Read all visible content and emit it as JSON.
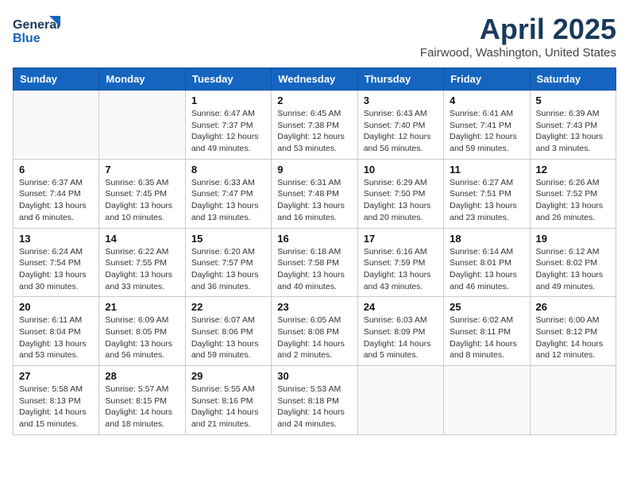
{
  "header": {
    "logo_line1": "General",
    "logo_line2": "Blue",
    "title": "April 2025",
    "location": "Fairwood, Washington, United States"
  },
  "weekdays": [
    "Sunday",
    "Monday",
    "Tuesday",
    "Wednesday",
    "Thursday",
    "Friday",
    "Saturday"
  ],
  "weeks": [
    [
      {
        "day": "",
        "detail": ""
      },
      {
        "day": "",
        "detail": ""
      },
      {
        "day": "1",
        "detail": "Sunrise: 6:47 AM\nSunset: 7:37 PM\nDaylight: 12 hours\nand 49 minutes."
      },
      {
        "day": "2",
        "detail": "Sunrise: 6:45 AM\nSunset: 7:38 PM\nDaylight: 12 hours\nand 53 minutes."
      },
      {
        "day": "3",
        "detail": "Sunrise: 6:43 AM\nSunset: 7:40 PM\nDaylight: 12 hours\nand 56 minutes."
      },
      {
        "day": "4",
        "detail": "Sunrise: 6:41 AM\nSunset: 7:41 PM\nDaylight: 12 hours\nand 59 minutes."
      },
      {
        "day": "5",
        "detail": "Sunrise: 6:39 AM\nSunset: 7:43 PM\nDaylight: 13 hours\nand 3 minutes."
      }
    ],
    [
      {
        "day": "6",
        "detail": "Sunrise: 6:37 AM\nSunset: 7:44 PM\nDaylight: 13 hours\nand 6 minutes."
      },
      {
        "day": "7",
        "detail": "Sunrise: 6:35 AM\nSunset: 7:45 PM\nDaylight: 13 hours\nand 10 minutes."
      },
      {
        "day": "8",
        "detail": "Sunrise: 6:33 AM\nSunset: 7:47 PM\nDaylight: 13 hours\nand 13 minutes."
      },
      {
        "day": "9",
        "detail": "Sunrise: 6:31 AM\nSunset: 7:48 PM\nDaylight: 13 hours\nand 16 minutes."
      },
      {
        "day": "10",
        "detail": "Sunrise: 6:29 AM\nSunset: 7:50 PM\nDaylight: 13 hours\nand 20 minutes."
      },
      {
        "day": "11",
        "detail": "Sunrise: 6:27 AM\nSunset: 7:51 PM\nDaylight: 13 hours\nand 23 minutes."
      },
      {
        "day": "12",
        "detail": "Sunrise: 6:26 AM\nSunset: 7:52 PM\nDaylight: 13 hours\nand 26 minutes."
      }
    ],
    [
      {
        "day": "13",
        "detail": "Sunrise: 6:24 AM\nSunset: 7:54 PM\nDaylight: 13 hours\nand 30 minutes."
      },
      {
        "day": "14",
        "detail": "Sunrise: 6:22 AM\nSunset: 7:55 PM\nDaylight: 13 hours\nand 33 minutes."
      },
      {
        "day": "15",
        "detail": "Sunrise: 6:20 AM\nSunset: 7:57 PM\nDaylight: 13 hours\nand 36 minutes."
      },
      {
        "day": "16",
        "detail": "Sunrise: 6:18 AM\nSunset: 7:58 PM\nDaylight: 13 hours\nand 40 minutes."
      },
      {
        "day": "17",
        "detail": "Sunrise: 6:16 AM\nSunset: 7:59 PM\nDaylight: 13 hours\nand 43 minutes."
      },
      {
        "day": "18",
        "detail": "Sunrise: 6:14 AM\nSunset: 8:01 PM\nDaylight: 13 hours\nand 46 minutes."
      },
      {
        "day": "19",
        "detail": "Sunrise: 6:12 AM\nSunset: 8:02 PM\nDaylight: 13 hours\nand 49 minutes."
      }
    ],
    [
      {
        "day": "20",
        "detail": "Sunrise: 6:11 AM\nSunset: 8:04 PM\nDaylight: 13 hours\nand 53 minutes."
      },
      {
        "day": "21",
        "detail": "Sunrise: 6:09 AM\nSunset: 8:05 PM\nDaylight: 13 hours\nand 56 minutes."
      },
      {
        "day": "22",
        "detail": "Sunrise: 6:07 AM\nSunset: 8:06 PM\nDaylight: 13 hours\nand 59 minutes."
      },
      {
        "day": "23",
        "detail": "Sunrise: 6:05 AM\nSunset: 8:08 PM\nDaylight: 14 hours\nand 2 minutes."
      },
      {
        "day": "24",
        "detail": "Sunrise: 6:03 AM\nSunset: 8:09 PM\nDaylight: 14 hours\nand 5 minutes."
      },
      {
        "day": "25",
        "detail": "Sunrise: 6:02 AM\nSunset: 8:11 PM\nDaylight: 14 hours\nand 8 minutes."
      },
      {
        "day": "26",
        "detail": "Sunrise: 6:00 AM\nSunset: 8:12 PM\nDaylight: 14 hours\nand 12 minutes."
      }
    ],
    [
      {
        "day": "27",
        "detail": "Sunrise: 5:58 AM\nSunset: 8:13 PM\nDaylight: 14 hours\nand 15 minutes."
      },
      {
        "day": "28",
        "detail": "Sunrise: 5:57 AM\nSunset: 8:15 PM\nDaylight: 14 hours\nand 18 minutes."
      },
      {
        "day": "29",
        "detail": "Sunrise: 5:55 AM\nSunset: 8:16 PM\nDaylight: 14 hours\nand 21 minutes."
      },
      {
        "day": "30",
        "detail": "Sunrise: 5:53 AM\nSunset: 8:18 PM\nDaylight: 14 hours\nand 24 minutes."
      },
      {
        "day": "",
        "detail": ""
      },
      {
        "day": "",
        "detail": ""
      },
      {
        "day": "",
        "detail": ""
      }
    ]
  ]
}
